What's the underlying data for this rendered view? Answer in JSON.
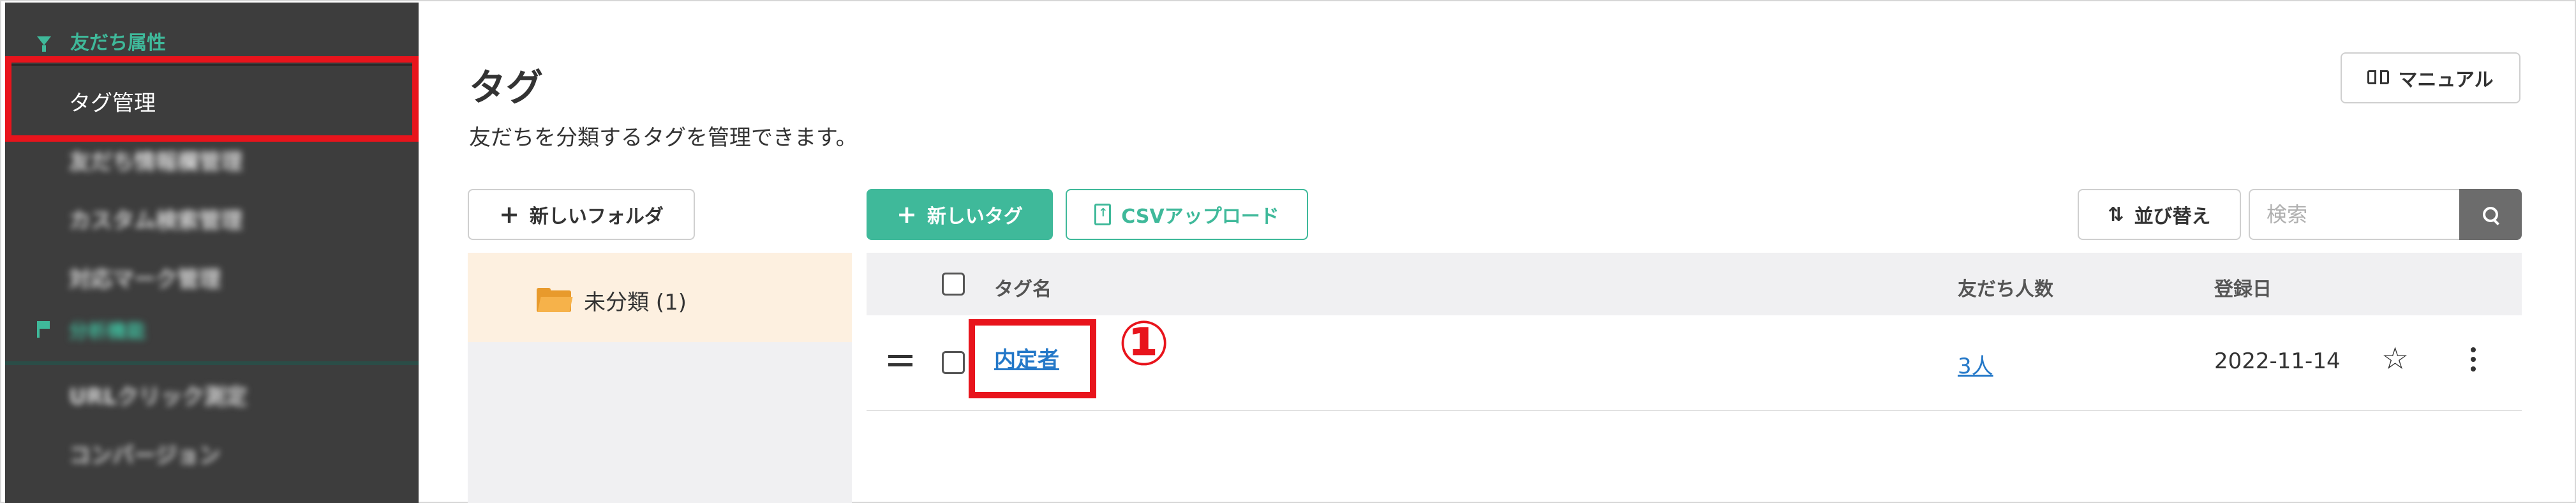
{
  "sidebar": {
    "section1": {
      "icon": "filter-icon",
      "label": "友だち属性"
    },
    "active_item": "タグ管理",
    "blurred_items": [
      "友だち情報欄管理",
      "カスタム検索管理",
      "対応マーク管理"
    ],
    "section2": {
      "icon": "flag-icon",
      "label": "分析機能"
    },
    "blurred_items2": [
      "URLクリック測定",
      "コンバージョン"
    ]
  },
  "header": {
    "title": "タグ",
    "description": "友だちを分類するタグを管理できます。",
    "manual_label": "マニュアル"
  },
  "toolbar": {
    "new_folder_label": "新しいフォルダ",
    "new_tag_label": "新しいタグ",
    "csv_upload_label": "CSVアップロード",
    "sort_label": "並び替え",
    "search_placeholder": "検索"
  },
  "folders": [
    {
      "label": "未分類 (1)"
    }
  ],
  "table": {
    "columns": [
      "タグ名",
      "友だち人数",
      "登録日"
    ],
    "rows": [
      {
        "name": "内定者",
        "count": "3人",
        "date": "2022-11-14"
      }
    ]
  },
  "annotation": {
    "marker": "①"
  },
  "colors": {
    "accent": "#3fb99a",
    "highlight": "#e8141c",
    "link": "#2478c8",
    "sidebar_bg": "#3d3d3d"
  }
}
